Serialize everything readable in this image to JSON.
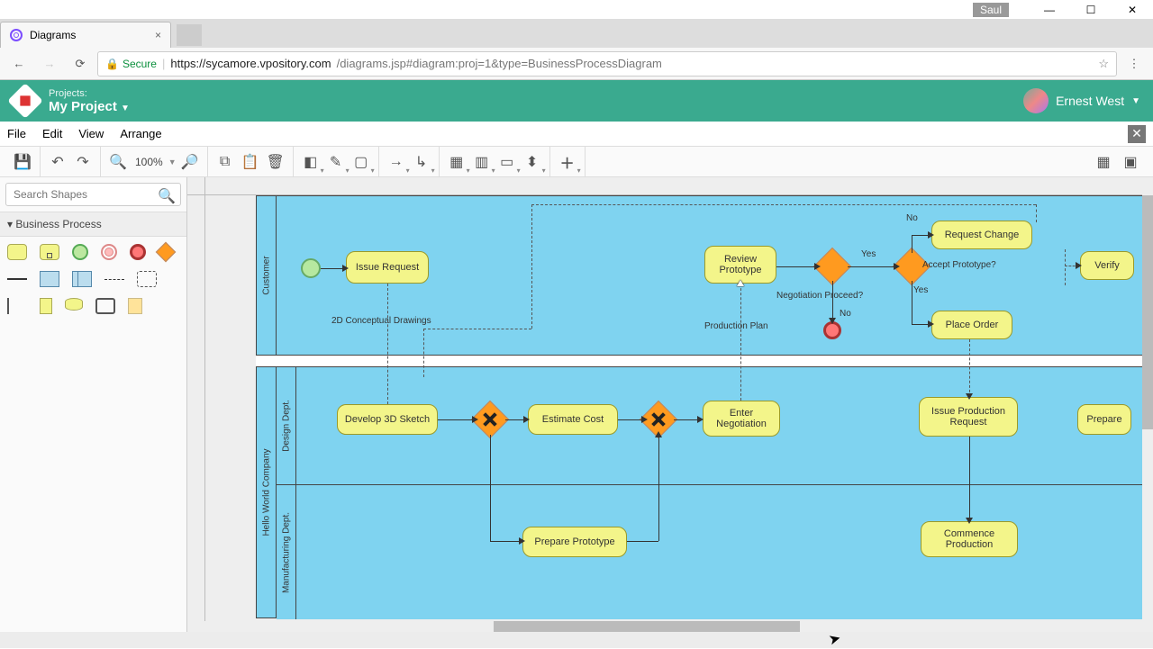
{
  "window": {
    "user_tag": "Saul"
  },
  "browser": {
    "tab_title": "Diagrams",
    "secure_label": "Secure",
    "url_host": "https://sycamore.vpository.com",
    "url_path": "/diagrams.jsp#diagram:proj=1&type=BusinessProcessDiagram"
  },
  "app": {
    "projects_label": "Projects:",
    "project_name": "My Project",
    "user_name": "Ernest West"
  },
  "menu": {
    "file": "File",
    "edit": "Edit",
    "view": "View",
    "arrange": "Arrange"
  },
  "toolbar": {
    "zoom": "100%"
  },
  "sidebar": {
    "search_placeholder": "Search Shapes",
    "section": "Business Process"
  },
  "diagram": {
    "pool_label": "Hello World Company",
    "lanes": {
      "customer": "Customer",
      "design": "Design Dept.",
      "manufacturing": "Manufacturing Dept."
    },
    "tasks": {
      "issue_request": "Issue Request",
      "review_prototype": "Review Prototype",
      "request_change": "Request Change",
      "place_order": "Place Order",
      "verify": "Verify",
      "develop_sketch": "Develop 3D Sketch",
      "estimate_cost": "Estimate Cost",
      "enter_negotiation": "Enter Negotiation",
      "issue_production": "Issue Production Request",
      "prepare": "Prepare",
      "prepare_prototype": "Prepare Prototype",
      "commence_production": "Commence Production"
    },
    "annotations": {
      "drawings": "2D Conceptual Drawings",
      "neg_proceed": "Negotiation Proceed?",
      "accept_proto": "Accept Prototype?",
      "prod_plan": "Production Plan",
      "yes1": "Yes",
      "no1": "No",
      "yes2": "Yes",
      "no2": "No"
    }
  }
}
